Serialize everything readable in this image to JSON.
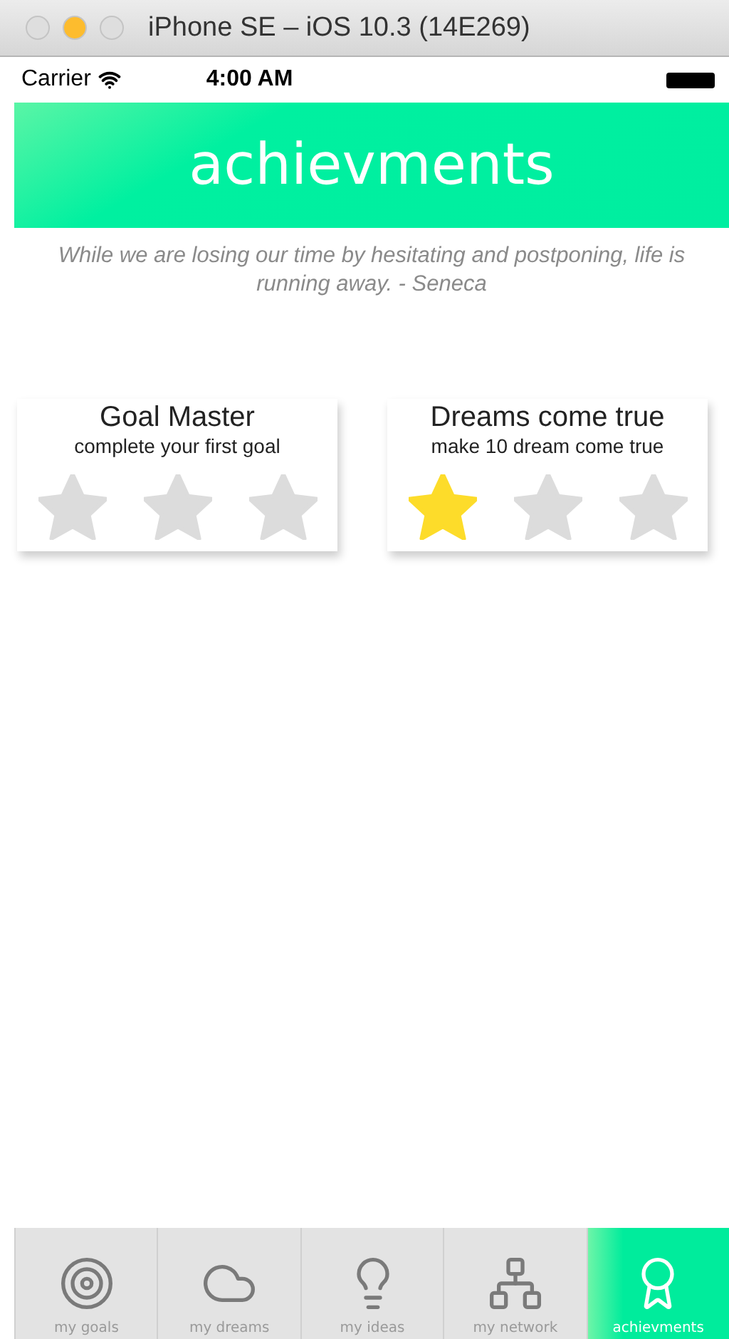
{
  "window": {
    "title": "iPhone SE – iOS 10.3 (14E269)"
  },
  "status_bar": {
    "carrier": "Carrier",
    "time": "4:00 AM"
  },
  "header": {
    "title": "achievments"
  },
  "quote": "While we are losing our time by hesitating and postponing, life is running away. - Seneca",
  "achievements": [
    {
      "title": "Goal Master",
      "description": "complete your first goal",
      "stars": 0
    },
    {
      "title": "Dreams come true",
      "description": "make 10 dream come true",
      "stars": 1
    }
  ],
  "tabs": [
    {
      "kind": "goals",
      "label": "my goals",
      "selected": false
    },
    {
      "kind": "dreams",
      "label": "my dreams",
      "selected": false
    },
    {
      "kind": "ideas",
      "label": "my ideas",
      "selected": false
    },
    {
      "kind": "network",
      "label": "my network",
      "selected": false
    },
    {
      "kind": "achievements",
      "label": "achievments",
      "selected": true
    }
  ]
}
